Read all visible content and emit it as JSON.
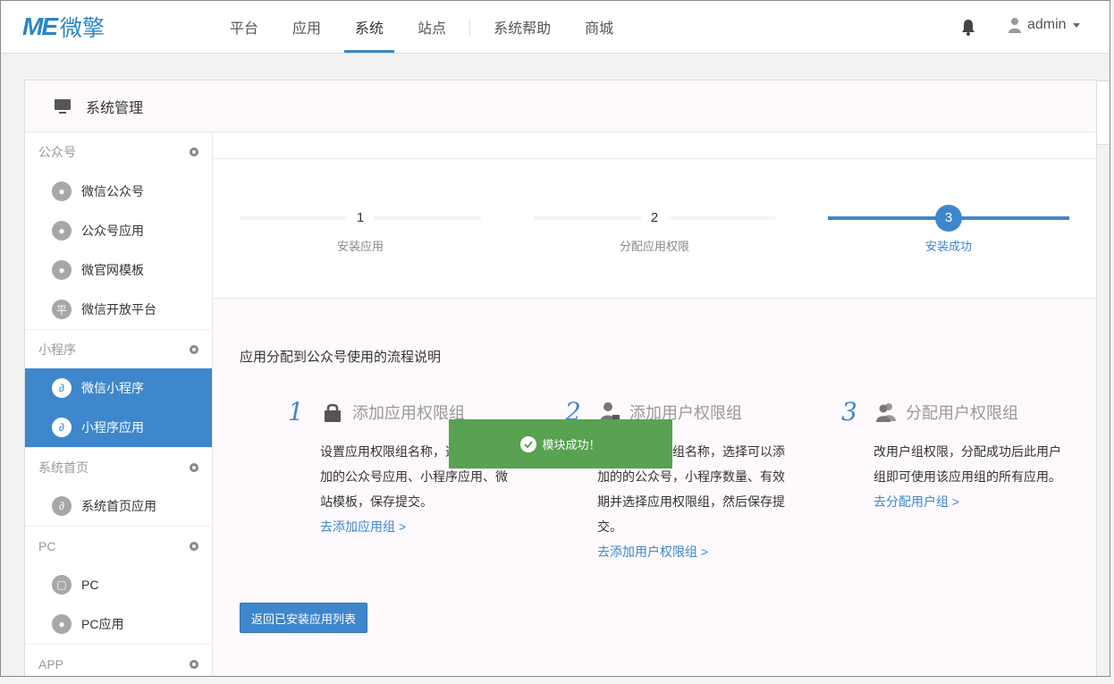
{
  "logo": {
    "mark": "ME",
    "text": "微擎"
  },
  "nav": {
    "items": [
      {
        "label": "平台"
      },
      {
        "label": "应用"
      },
      {
        "label": "系统"
      },
      {
        "label": "站点"
      },
      {
        "label": "系统帮助"
      },
      {
        "label": "商城"
      }
    ],
    "active": "系统"
  },
  "user": {
    "name": "admin"
  },
  "panel": {
    "title": "系统管理"
  },
  "sidebar": {
    "groups": [
      {
        "title": "公众号",
        "items": [
          "微信公众号",
          "公众号应用",
          "微官网模板",
          "微信开放平台"
        ]
      },
      {
        "title": "小程序",
        "items": [
          "微信小程序",
          "小程序应用"
        ]
      },
      {
        "title": "系统首页",
        "items": [
          "系统首页应用"
        ]
      },
      {
        "title": "PC",
        "items": [
          "PC",
          "PC应用"
        ]
      },
      {
        "title": "APP",
        "items": []
      }
    ]
  },
  "steps": [
    {
      "num": "1",
      "label": "安装应用"
    },
    {
      "num": "2",
      "label": "分配应用权限"
    },
    {
      "num": "3",
      "label": "安装成功"
    }
  ],
  "flow": {
    "title": "应用分配到公众号使用的流程说明",
    "columns": [
      {
        "num": "1",
        "title": "添加应用权限组",
        "desc": "设置应用权限组名称，选择可以添加的公众号应用、小程序应用、微站模板，保存提交。",
        "link": "去添加应用组 >"
      },
      {
        "num": "2",
        "title": "添加用户权限组",
        "desc": "设置用户权限组名称，选择可以添加的的公众号，小程序数量、有效期并选择应用权限组，然后保存提交。",
        "link": "去添加用户权限组 >"
      },
      {
        "num": "3",
        "title": "分配用户权限组",
        "desc": "改用户组权限，分配成功后此用户组即可使用该应用组的所有应用。",
        "link": "去分配用户组 >"
      }
    ]
  },
  "back_button": "返回已安装应用列表",
  "toast": {
    "message": "模块成功！"
  },
  "colors": {
    "accent": "#3e87cc",
    "toast": "#58a251"
  }
}
